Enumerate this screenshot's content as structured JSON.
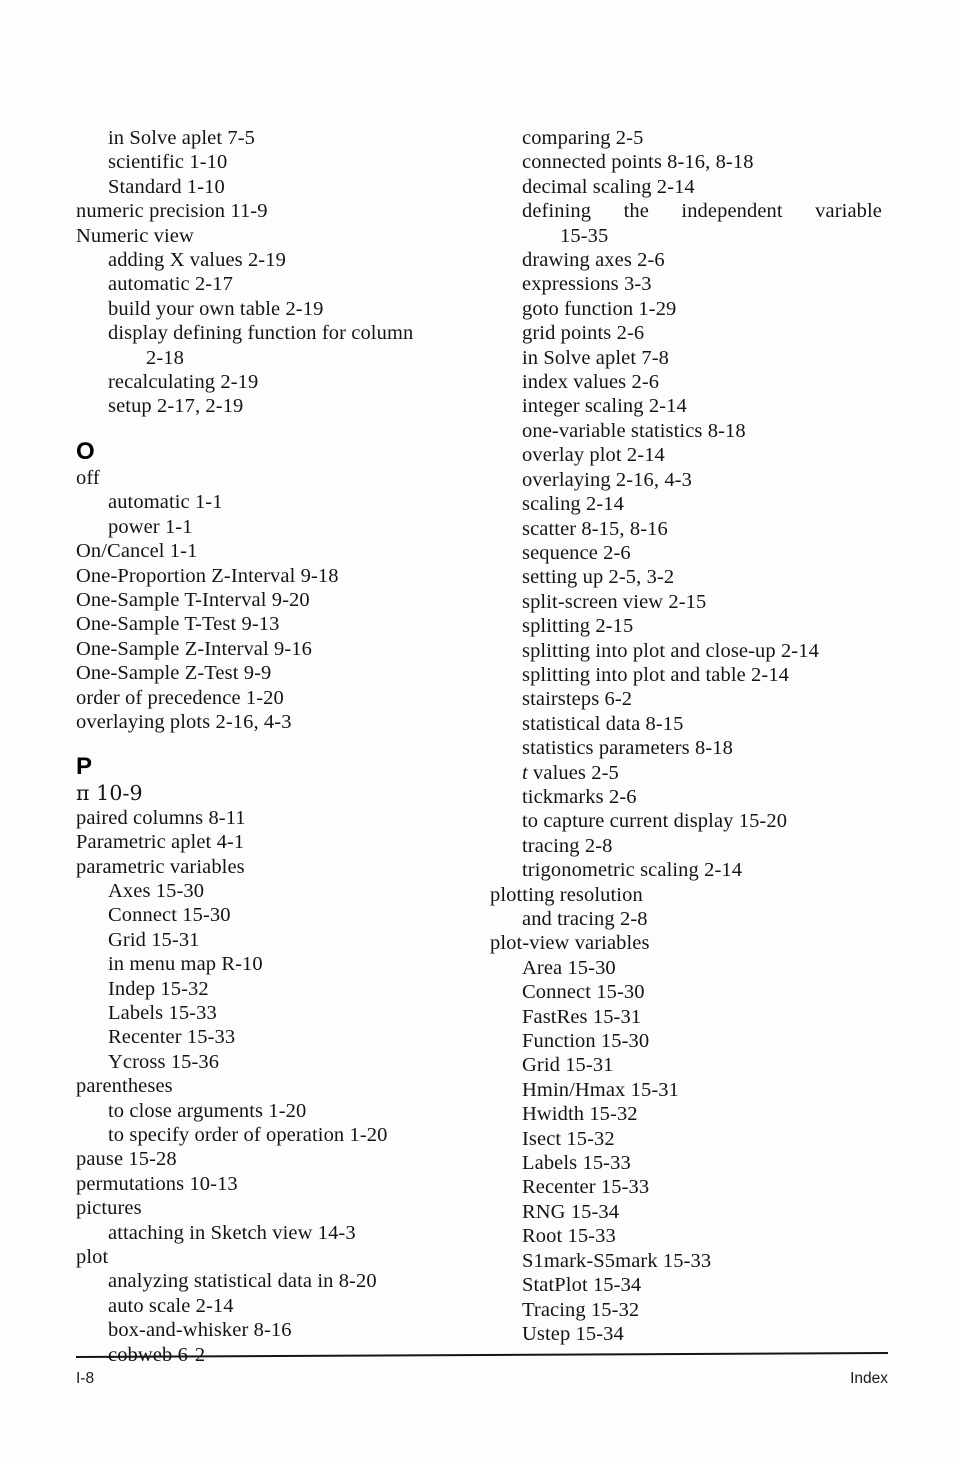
{
  "page": {
    "footer_page_number": "I-8",
    "footer_label": "Index"
  },
  "columns": {
    "left": [
      {
        "level": 1,
        "text": "in Solve aplet 7-5"
      },
      {
        "level": 1,
        "text": "scientific 1-10"
      },
      {
        "level": 1,
        "text": "Standard 1-10"
      },
      {
        "level": 0,
        "text": "numeric precision 11-9"
      },
      {
        "level": 0,
        "text": "Numeric view"
      },
      {
        "level": 1,
        "text": "adding X values 2-19"
      },
      {
        "level": 1,
        "text": "automatic 2-17"
      },
      {
        "level": 1,
        "text": "build your own table 2-19"
      },
      {
        "level": 1,
        "text": "display defining function for column"
      },
      {
        "level": 2,
        "text": "2-18"
      },
      {
        "level": 1,
        "text": "recalculating 2-19"
      },
      {
        "level": 1,
        "text": "setup 2-17, 2-19"
      },
      {
        "level": "heading",
        "text": "O"
      },
      {
        "level": 0,
        "text": "off"
      },
      {
        "level": 1,
        "text": "automatic 1-1"
      },
      {
        "level": 1,
        "text": "power 1-1"
      },
      {
        "level": 0,
        "text": "On/Cancel 1-1"
      },
      {
        "level": 0,
        "text": "One-Proportion Z-Interval 9-18"
      },
      {
        "level": 0,
        "text": "One-Sample T-Interval 9-20"
      },
      {
        "level": 0,
        "text": "One-Sample T-Test 9-13"
      },
      {
        "level": 0,
        "text": "One-Sample Z-Interval 9-16"
      },
      {
        "level": 0,
        "text": "One-Sample Z-Test 9-9"
      },
      {
        "level": 0,
        "text": "order of precedence 1-20"
      },
      {
        "level": 0,
        "text": "overlaying plots 2-16, 4-3"
      },
      {
        "level": "heading",
        "text": "P"
      },
      {
        "level": 0,
        "text": "π 10-9"
      },
      {
        "level": 0,
        "text": "paired columns 8-11"
      },
      {
        "level": 0,
        "text": "Parametric aplet 4-1"
      },
      {
        "level": 0,
        "text": "parametric variables"
      },
      {
        "level": 1,
        "text": "Axes 15-30"
      },
      {
        "level": 1,
        "text": "Connect 15-30"
      },
      {
        "level": 1,
        "text": "Grid 15-31"
      },
      {
        "level": 1,
        "text": "in menu map R-10"
      },
      {
        "level": 1,
        "text": "Indep 15-32"
      },
      {
        "level": 1,
        "text": "Labels 15-33"
      },
      {
        "level": 1,
        "text": "Recenter 15-33"
      },
      {
        "level": 1,
        "text": "Ycross 15-36"
      },
      {
        "level": 0,
        "text": "parentheses"
      },
      {
        "level": 1,
        "text": "to close arguments 1-20"
      },
      {
        "level": 1,
        "text": "to specify order of operation 1-20"
      },
      {
        "level": 0,
        "text": "pause 15-28"
      },
      {
        "level": 0,
        "text": "permutations 10-13"
      },
      {
        "level": 0,
        "text": "pictures"
      },
      {
        "level": 1,
        "text": "attaching in Sketch view 14-3"
      },
      {
        "level": 0,
        "text": "plot"
      },
      {
        "level": 1,
        "text": "analyzing statistical data in 8-20"
      },
      {
        "level": 1,
        "text": "auto scale 2-14"
      },
      {
        "level": 1,
        "text": "box-and-whisker 8-16"
      },
      {
        "level": 1,
        "text": "cobweb 6-2"
      }
    ],
    "right": [
      {
        "level": 1,
        "text": "comparing 2-5"
      },
      {
        "level": 1,
        "text": "connected points 8-16, 8-18"
      },
      {
        "level": 1,
        "text": "decimal scaling 2-14"
      },
      {
        "level": 1,
        "text": "defining the independent variable",
        "justified": true
      },
      {
        "level": 2,
        "text": "15-35"
      },
      {
        "level": 1,
        "text": "drawing axes 2-6"
      },
      {
        "level": 1,
        "text": "expressions 3-3"
      },
      {
        "level": 1,
        "text": "goto function 1-29"
      },
      {
        "level": 1,
        "text": "grid points 2-6"
      },
      {
        "level": 1,
        "text": "in Solve aplet 7-8"
      },
      {
        "level": 1,
        "text": "index values 2-6"
      },
      {
        "level": 1,
        "text": "integer scaling 2-14"
      },
      {
        "level": 1,
        "text": "one-variable statistics 8-18"
      },
      {
        "level": 1,
        "text": "overlay plot 2-14"
      },
      {
        "level": 1,
        "text": "overlaying 2-16, 4-3"
      },
      {
        "level": 1,
        "text": "scaling 2-14"
      },
      {
        "level": 1,
        "text": "scatter 8-15, 8-16"
      },
      {
        "level": 1,
        "text": "sequence 2-6"
      },
      {
        "level": 1,
        "text": "setting up 2-5, 3-2"
      },
      {
        "level": 1,
        "text": "split-screen view 2-15"
      },
      {
        "level": 1,
        "text": "splitting 2-15"
      },
      {
        "level": 1,
        "text": "splitting into plot and close-up 2-14"
      },
      {
        "level": 1,
        "text": "splitting into plot and table 2-14"
      },
      {
        "level": 1,
        "text": "stairsteps 6-2"
      },
      {
        "level": 1,
        "text": "statistical data 8-15"
      },
      {
        "level": 1,
        "text": "statistics parameters 8-18"
      },
      {
        "level": 1,
        "text": "t values 2-5",
        "italic_prefix": "t",
        "rest": " values 2-5"
      },
      {
        "level": 1,
        "text": "tickmarks 2-6"
      },
      {
        "level": 1,
        "text": "to capture current display 15-20"
      },
      {
        "level": 1,
        "text": "tracing 2-8"
      },
      {
        "level": 1,
        "text": "trigonometric scaling 2-14"
      },
      {
        "level": 0,
        "text": "plotting resolution"
      },
      {
        "level": 1,
        "text": "and tracing 2-8"
      },
      {
        "level": 0,
        "text": "plot-view variables"
      },
      {
        "level": 1,
        "text": "Area 15-30"
      },
      {
        "level": 1,
        "text": "Connect 15-30"
      },
      {
        "level": 1,
        "text": "FastRes 15-31"
      },
      {
        "level": 1,
        "text": "Function 15-30"
      },
      {
        "level": 1,
        "text": "Grid 15-31"
      },
      {
        "level": 1,
        "text": "Hmin/Hmax 15-31"
      },
      {
        "level": 1,
        "text": "Hwidth 15-32"
      },
      {
        "level": 1,
        "text": "Isect 15-32"
      },
      {
        "level": 1,
        "text": "Labels 15-33"
      },
      {
        "level": 1,
        "text": "Recenter 15-33"
      },
      {
        "level": 1,
        "text": "RNG 15-34"
      },
      {
        "level": 1,
        "text": "Root 15-33"
      },
      {
        "level": 1,
        "text": "S1mark-S5mark 15-33"
      },
      {
        "level": 1,
        "text": "StatPlot 15-34"
      },
      {
        "level": 1,
        "text": "Tracing 15-32"
      },
      {
        "level": 1,
        "text": "Ustep 15-34"
      }
    ]
  }
}
